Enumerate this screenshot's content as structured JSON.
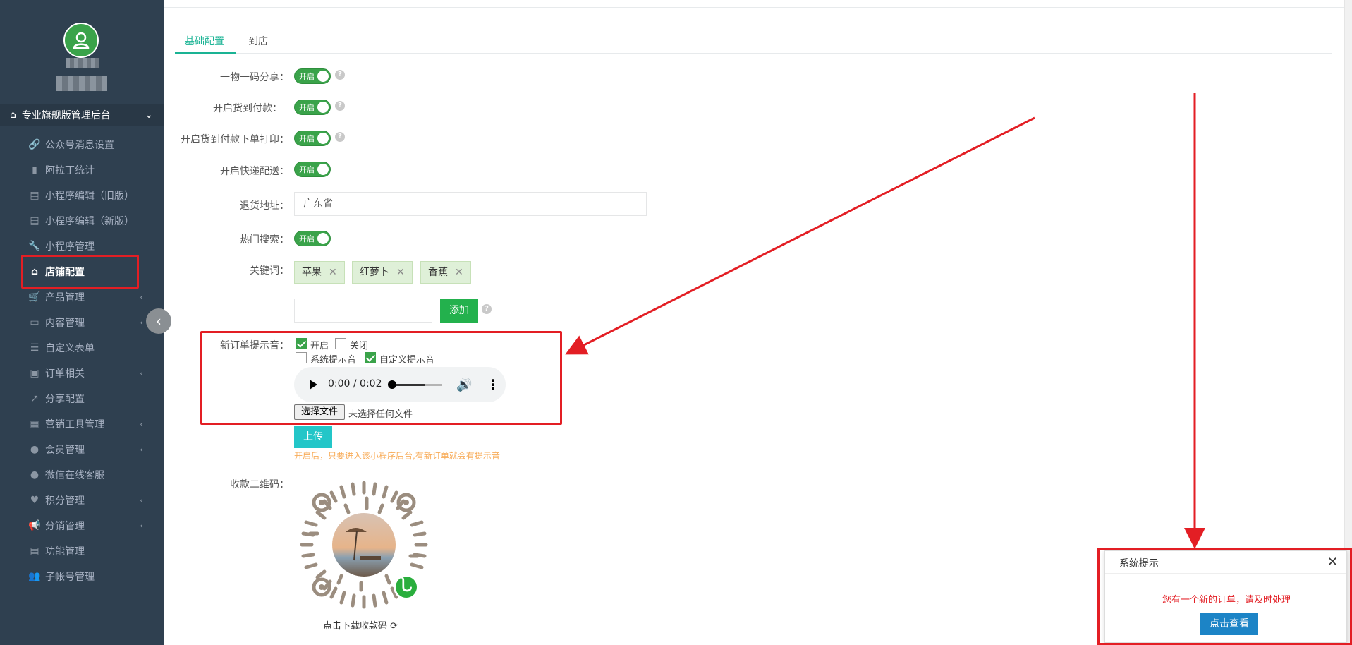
{
  "sidebar": {
    "header_title": "专业旗舰版管理后台",
    "items": [
      {
        "label": "公众号消息设置",
        "icon": "link-icon",
        "has_arrow": false
      },
      {
        "label": "阿拉丁统计",
        "icon": "bar-chart-icon",
        "has_arrow": false
      },
      {
        "label": "小程序编辑（旧版）",
        "icon": "book-icon",
        "has_arrow": false
      },
      {
        "label": "小程序编辑（新版）",
        "icon": "book-icon",
        "has_arrow": false
      },
      {
        "label": "小程序管理",
        "icon": "wrench-icon",
        "has_arrow": false
      },
      {
        "label": "店铺配置",
        "icon": "home-icon",
        "has_arrow": false,
        "active": true
      },
      {
        "label": "产品管理",
        "icon": "cart-icon",
        "has_arrow": true
      },
      {
        "label": "内容管理",
        "icon": "folder-icon",
        "has_arrow": true
      },
      {
        "label": "自定义表单",
        "icon": "list-icon",
        "has_arrow": false
      },
      {
        "label": "订单相关",
        "icon": "order-icon",
        "has_arrow": true
      },
      {
        "label": "分享配置",
        "icon": "share-icon",
        "has_arrow": false
      },
      {
        "label": "营销工具管理",
        "icon": "grid-icon",
        "has_arrow": true
      },
      {
        "label": "会员管理",
        "icon": "user-icon",
        "has_arrow": true
      },
      {
        "label": "微信在线客服",
        "icon": "user-icon",
        "has_arrow": false
      },
      {
        "label": "积分管理",
        "icon": "heart-icon",
        "has_arrow": true
      },
      {
        "label": "分销管理",
        "icon": "bullhorn-icon",
        "has_arrow": true
      },
      {
        "label": "功能管理",
        "icon": "book-icon",
        "has_arrow": false
      },
      {
        "label": "子帐号管理",
        "icon": "users-icon",
        "has_arrow": false
      }
    ]
  },
  "tabs": [
    "基础配置",
    "到店"
  ],
  "form": {
    "share_label": "一物一码分享：",
    "cod_label": "开启货到付款：",
    "cod_print_label": "开启货到付款下单打印：",
    "express_label": "开启快递配送：",
    "return_addr_label": "退货地址：",
    "return_addr_value": "广东省",
    "hot_search_label": "热门搜索：",
    "keywords_label": "关键词：",
    "toggle_on": "开启",
    "keywords": [
      "苹果",
      "红萝卜",
      "香蕉"
    ],
    "keyword_input_value": "",
    "add_button": "添加",
    "order_sound_label": "新订单提示音：",
    "sound_on": "开启",
    "sound_off": "关闭",
    "sound_system": "系统提示音",
    "sound_custom": "自定义提示音",
    "audio_time": "0:00 / 0:02",
    "audio_progress": 0.0,
    "choose_file": "选择文件",
    "file_status": "未选择任何文件",
    "upload_button": "上传",
    "hint": "开启后，只要进入该小程序后台,有新订单就会有提示音",
    "qr_label": "收款二维码：",
    "qr_caption": "点击下载收款码"
  },
  "popup": {
    "title": "系统提示",
    "message": "您有一个新的订单，请及时处理",
    "button": "点击查看"
  },
  "colors": {
    "sidebar_bg": "#2f4050",
    "accent": "#1ab394",
    "toggle_green": "#3aa34a",
    "annotation_red": "#e31e24",
    "popup_button": "#1c84c6"
  }
}
